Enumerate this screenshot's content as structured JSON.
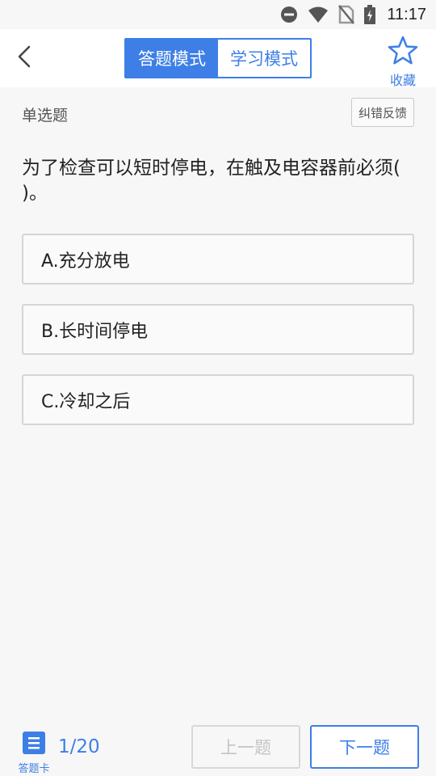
{
  "status_bar": {
    "time": "11:17",
    "icons": [
      "do-not-disturb-icon",
      "wifi-icon",
      "no-sim-icon",
      "battery-charging-icon"
    ]
  },
  "header": {
    "back_icon": "chevron-left-icon",
    "tabs": [
      {
        "label": "答题模式",
        "active": true
      },
      {
        "label": "学习模式",
        "active": false
      }
    ],
    "favorite_label": "收藏",
    "favorite_icon": "star-outline-icon"
  },
  "question": {
    "type_label": "单选题",
    "feedback_label": "纠错反馈",
    "text": "为了检查可以短时停电，在触及电容器前必须( )。",
    "options": [
      {
        "label": "A.充分放电"
      },
      {
        "label": "B.长时间停电"
      },
      {
        "label": "C.冷却之后"
      }
    ]
  },
  "footer": {
    "answer_card_label": "答题卡",
    "answer_card_icon": "list-icon",
    "progress": "1/20",
    "prev_label": "上一题",
    "next_label": "下一题"
  },
  "colors": {
    "accent": "#3d7fe6",
    "background": "#f7f7f7",
    "border": "#d5d5d5",
    "disabled_text": "#c4c4c4"
  }
}
